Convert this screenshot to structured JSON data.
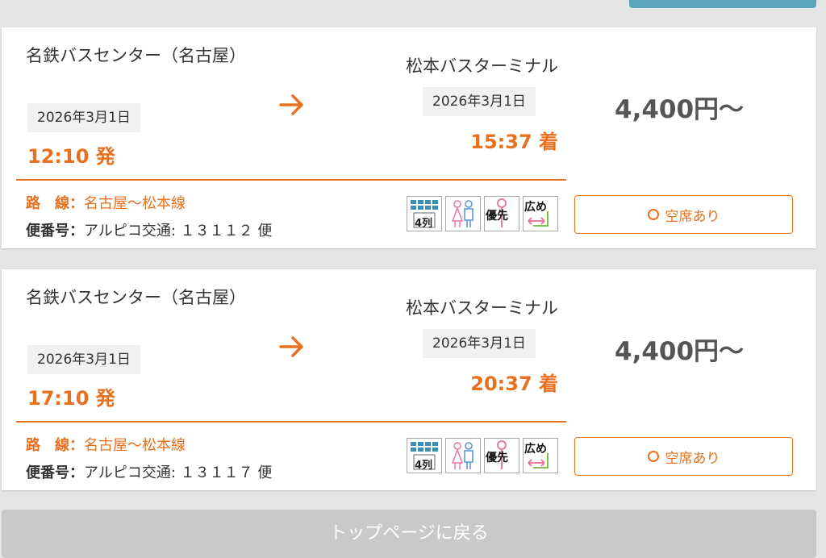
{
  "results": [
    {
      "departure": {
        "name": "名鉄バスセンター（名古屋）",
        "date": "2026年3月1日",
        "time": "12:10 発"
      },
      "arrival": {
        "name": "松本バスターミナル",
        "date": "2026年3月1日",
        "time": "15:37 着"
      },
      "price": "4,400円〜",
      "route_label": "路　線：",
      "route_value": "名古屋〜松本線",
      "flight_label": "便番号：",
      "flight_value": "アルピコ交通: １３１１２ 便",
      "seat_button": "空席あり"
    },
    {
      "departure": {
        "name": "名鉄バスセンター（名古屋）",
        "date": "2026年3月1日",
        "time": "17:10 発"
      },
      "arrival": {
        "name": "松本バスターミナル",
        "date": "2026年3月1日",
        "time": "20:37 着"
      },
      "price": "4,400円〜",
      "route_label": "路　線：",
      "route_value": "名古屋〜松本線",
      "flight_label": "便番号：",
      "flight_value": "アルピコ交通: １３１１７ 便",
      "seat_button": "空席あり"
    }
  ],
  "icons": [
    {
      "name": "4-row-seat-icon",
      "text": "4列"
    },
    {
      "name": "women-men-icon",
      "text": ""
    },
    {
      "name": "priority-seat-icon",
      "text": "優先"
    },
    {
      "name": "wide-seat-icon",
      "text": "広め"
    }
  ],
  "bottom_button": "トップページに戻る",
  "colors": {
    "accent": "#e8701e",
    "top_button": "#5ea6bd"
  }
}
